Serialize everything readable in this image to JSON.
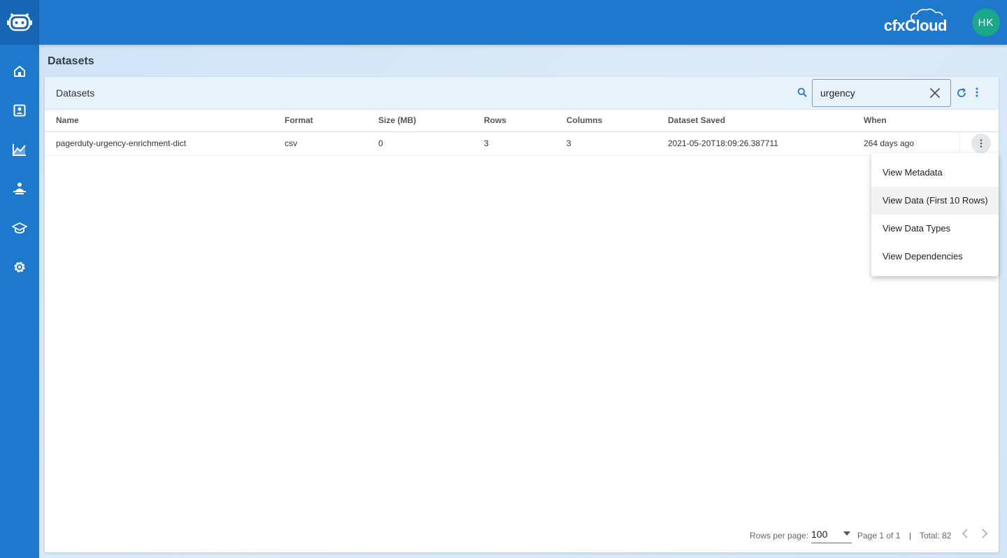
{
  "brand": {
    "name": "cfxCloud"
  },
  "user": {
    "initials": "HK"
  },
  "page": {
    "title": "Datasets"
  },
  "sidebar": {
    "items": [
      {
        "name": "home",
        "icon": "home-icon"
      },
      {
        "name": "contacts",
        "icon": "contact-card-icon"
      },
      {
        "name": "analytics",
        "icon": "chart-line-icon"
      },
      {
        "name": "user-admin",
        "icon": "person-desk-icon"
      },
      {
        "name": "learning",
        "icon": "graduation-cap-icon"
      },
      {
        "name": "settings",
        "icon": "gear-icon"
      }
    ]
  },
  "card": {
    "title": "Datasets",
    "search": {
      "value": "urgency",
      "placeholder": ""
    }
  },
  "table": {
    "columns": [
      "Name",
      "Format",
      "Size (MB)",
      "Rows",
      "Columns",
      "Dataset Saved",
      "When"
    ],
    "rows": [
      {
        "name": "pagerduty-urgency-enrichment-dict",
        "format": "csv",
        "size": "0",
        "rows": "3",
        "columns": "3",
        "saved": "2021-05-20T18:09:26.387711",
        "when": "264 days ago"
      }
    ]
  },
  "menu": {
    "items": [
      "View Metadata",
      "View Data (First 10 Rows)",
      "View Data Types",
      "View Dependencies"
    ]
  },
  "pagination": {
    "rows_per_page_label": "Rows per page:",
    "rows_per_page": "100",
    "page_info": "Page 1 of 1",
    "separator": "|",
    "total": "Total: 82"
  },
  "colors": {
    "primary": "#1e78cc",
    "primary_dark": "#1766b5",
    "avatar": "#1ba88a",
    "header_bg": "#e8f2fb"
  }
}
